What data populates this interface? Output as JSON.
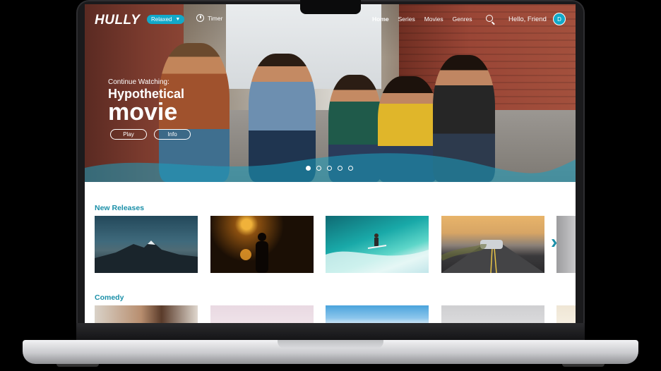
{
  "app": {
    "logo": "HULLY",
    "mood": "Relaxed",
    "timer_label": "Timer",
    "greeting": "Hello, Friend",
    "avatar_initial": "D"
  },
  "nav": {
    "items": [
      {
        "label": "Home",
        "active": true
      },
      {
        "label": "Series",
        "active": false
      },
      {
        "label": "Movies",
        "active": false
      },
      {
        "label": "Genres",
        "active": false
      }
    ]
  },
  "hero": {
    "subtitle": "Continue Watching:",
    "title_line1": "Hypothetical",
    "title_line2": "movie",
    "play_label": "Play",
    "info_label": "Info",
    "slide_count": 5,
    "active_slide": 1
  },
  "sections": [
    {
      "title": "New Releases",
      "thumbnails": [
        "mountain",
        "silhouette-lights",
        "surfer-wave",
        "car-road",
        "partial"
      ]
    },
    {
      "title": "Comedy",
      "thumbnails": [
        "woman-glasses",
        "hands-sky",
        "blue-sky",
        "gray",
        "partial"
      ]
    }
  ],
  "colors": {
    "accent": "#12a9c9",
    "section_title": "#1a8fa8"
  },
  "icons": [
    "timer-icon",
    "search-icon",
    "chevron-right-icon",
    "caret-down-icon"
  ]
}
